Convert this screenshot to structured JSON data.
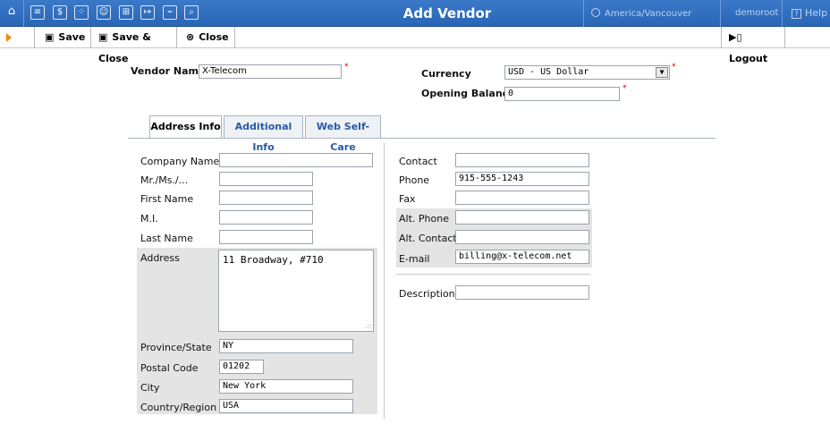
{
  "header": {
    "title": "Add Vendor",
    "timezone": "America/Vancouver",
    "user": "demoroot",
    "help": "Help",
    "icons": [
      "home-icon",
      "document-icon",
      "dollar-icon",
      "network-icon",
      "person-icon",
      "hierarchy-icon",
      "export-icon",
      "chart-icon",
      "search-icon"
    ]
  },
  "toolbar": {
    "save": "Save",
    "save_close": "Save & Close",
    "close": "Close",
    "logout": "Logout"
  },
  "vendor": {
    "name_label": "Vendor Name",
    "name_value": "X-Telecom",
    "currency_label": "Currency",
    "currency_value": "USD - US Dollar",
    "balance_label": "Opening Balance",
    "balance_value": "0",
    "required_mark": "*"
  },
  "tabs": {
    "address": "Address Info",
    "additional": "Additional Info",
    "selfcare": "Web Self-Care"
  },
  "address": {
    "company_label": "Company Name",
    "company_value": "",
    "salutation_label": "Mr./Ms./...",
    "salutation_value": "",
    "first_label": "First Name",
    "first_value": "",
    "mi_label": "M.I.",
    "mi_value": "",
    "last_label": "Last Name",
    "last_value": "",
    "address_label": "Address",
    "address_value": "11 Broadway, #710",
    "province_label": "Province/State",
    "province_value": "NY",
    "postal_label": "Postal Code",
    "postal_value": "01202",
    "city_label": "City",
    "city_value": "New York",
    "country_label": "Country/Region",
    "country_value": "USA"
  },
  "contact": {
    "contact_label": "Contact",
    "contact_value": "",
    "phone_label": "Phone",
    "phone_value": "915-555-1243",
    "fax_label": "Fax",
    "fax_value": "",
    "altphone_label": "Alt. Phone",
    "altphone_value": "",
    "altcontact_label": "Alt. Contact",
    "altcontact_value": "",
    "email_label": "E-mail",
    "email_value": "billing@x-telecom.net",
    "desc_label": "Description",
    "desc_value": ""
  },
  "colors": {
    "header_blue": "#2f6dbf",
    "accent_orange": "#f08c00",
    "required_red": "#d40000",
    "tab_link": "#2759a5"
  }
}
